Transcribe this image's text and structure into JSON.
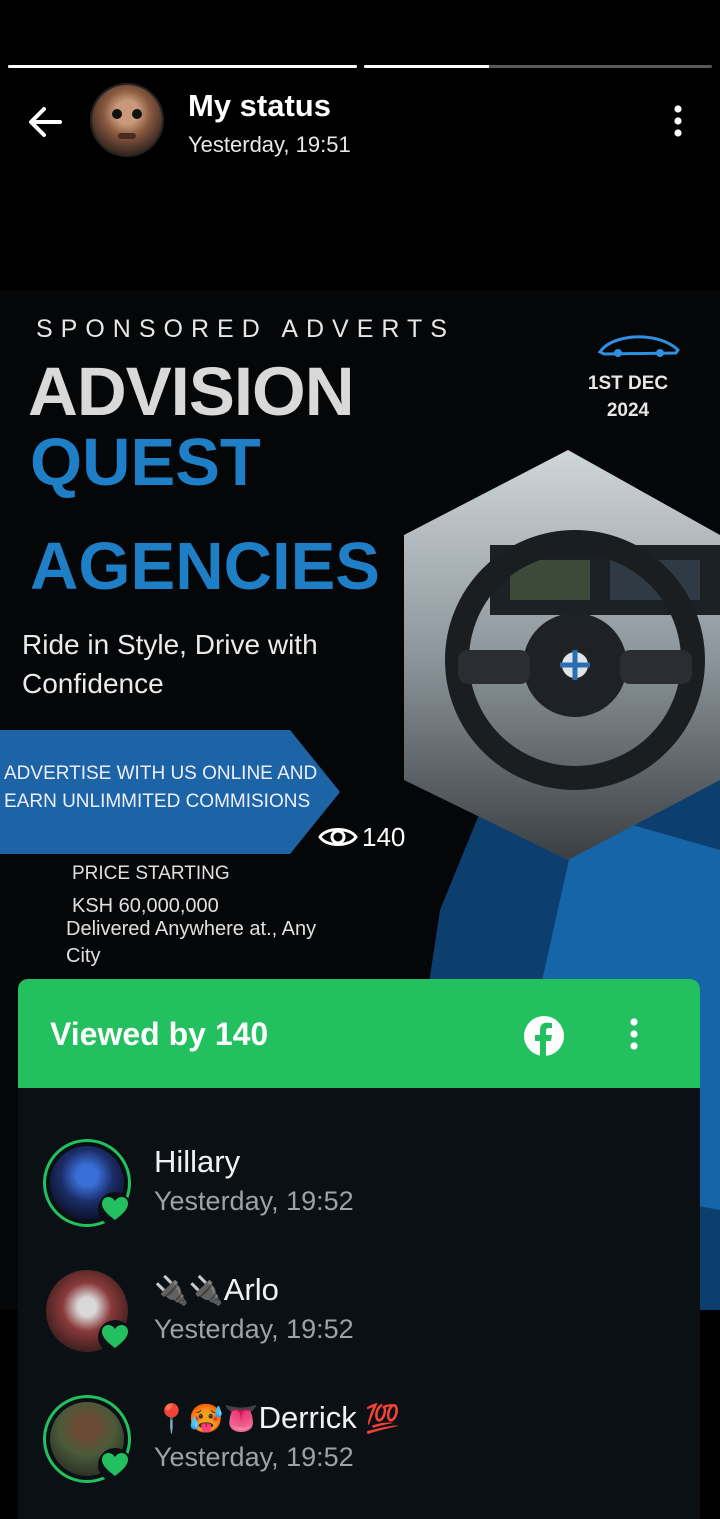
{
  "progress": [
    1.0,
    0.36
  ],
  "header": {
    "title": "My status",
    "subtitle": "Yesterday, 19:51"
  },
  "poster": {
    "sponsored": "SPONSORED ADVERTS",
    "line1": "ADVISION",
    "line2": "QUEST",
    "line3": "AGENCIES",
    "tagline": "Ride in Style, Drive with Confidence",
    "date": "1ST DEC 2024",
    "banner": "ADVERTISE WITH  US ONLINE AND EARN UNLIMMITED COMMISIONS",
    "price_label": "PRICE STARTING",
    "price_value": "KSH 60,000,000",
    "delivery": "Delivered Anywhere at., Any City"
  },
  "views_count": "140",
  "sheet": {
    "title": "Viewed by 140",
    "viewers": [
      {
        "name": "Hillary",
        "time": "Yesterday, 19:52"
      },
      {
        "prefix": "🔌🔌",
        "name": "Arlo",
        "time": "Yesterday, 19:52"
      },
      {
        "prefix": "📍🥵👅",
        "name": "Derrick",
        "suffix": "💯",
        "time": "Yesterday, 19:52"
      }
    ]
  },
  "colors": {
    "accent_green": "#22c05f",
    "poster_blue": "#1e7fc6",
    "sheet_bg": "#0b1014"
  },
  "icons": [
    "back-arrow-icon",
    "more-vertical-icon",
    "eye-icon",
    "facebook-icon",
    "heart-icon"
  ]
}
